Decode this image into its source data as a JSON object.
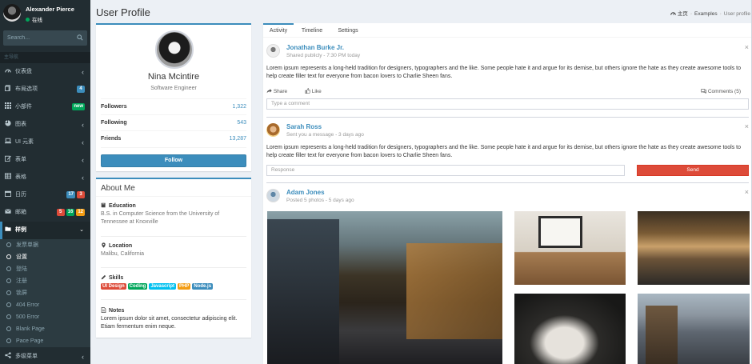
{
  "user": {
    "name": "Alexander Pierce",
    "status": "在线"
  },
  "search": {
    "placeholder": "Search..."
  },
  "sidebar": {
    "header": "主导航",
    "items": [
      {
        "label": "仪表盘",
        "icon": "dashboard-icon"
      },
      {
        "label": "布局选项",
        "icon": "files-icon",
        "badges": [
          {
            "text": "4",
            "color": "#3c8dbc"
          }
        ]
      },
      {
        "label": "小部件",
        "icon": "th-icon",
        "badges": [
          {
            "text": "new",
            "color": "#00a65a"
          }
        ]
      },
      {
        "label": "图表",
        "icon": "pie-chart-icon"
      },
      {
        "label": "UI 元素",
        "icon": "laptop-icon"
      },
      {
        "label": "表单",
        "icon": "edit-icon"
      },
      {
        "label": "表格",
        "icon": "table-icon"
      },
      {
        "label": "日历",
        "icon": "calendar-icon",
        "badges": [
          {
            "text": "17",
            "color": "#3c8dbc"
          },
          {
            "text": "3",
            "color": "#dd4b39"
          }
        ]
      },
      {
        "label": "邮箱",
        "icon": "envelope-icon",
        "badges": [
          {
            "text": "5",
            "color": "#dd4b39"
          },
          {
            "text": "16",
            "color": "#00a65a"
          },
          {
            "text": "12",
            "color": "#f39c12"
          }
        ]
      },
      {
        "label": "样例",
        "icon": "folder-icon"
      }
    ],
    "subitems": [
      "发票单据",
      "设置",
      "登陆",
      "注册",
      "锁屏",
      "404 Error",
      "500 Error",
      "Blank Page",
      "Pace Page"
    ],
    "bottom": "多级菜单"
  },
  "page": {
    "title": "User Profile"
  },
  "breadcrumb": {
    "home": "主页",
    "section": "Examples",
    "current": "User profile"
  },
  "profile": {
    "name": "Nina Mcintire",
    "job": "Software Engineer",
    "stats": [
      {
        "label": "Followers",
        "value": "1,322"
      },
      {
        "label": "Following",
        "value": "543"
      },
      {
        "label": "Friends",
        "value": "13,287"
      }
    ],
    "follow": "Follow"
  },
  "about": {
    "title": "About Me",
    "education": {
      "title": "Education",
      "text": "B.S. in Computer Science from the University of Tennessee at Knoxville"
    },
    "location": {
      "title": "Location",
      "text": "Malibu, California"
    },
    "skills": {
      "title": "Skills",
      "labels": [
        {
          "text": "UI Design",
          "color": "#dd4b39"
        },
        {
          "text": "Coding",
          "color": "#00a65a"
        },
        {
          "text": "Javascript",
          "color": "#00c0ef"
        },
        {
          "text": "PHP",
          "color": "#f39c12"
        },
        {
          "text": "Node.js",
          "color": "#3c8dbc"
        }
      ]
    },
    "notes": {
      "title": "Notes",
      "text": "Lorem ipsum dolor sit amet, consectetur adipiscing elit. Etiam fermentum enim neque."
    }
  },
  "tabs": [
    "Activity",
    "Timeline",
    "Settings"
  ],
  "posts": [
    {
      "name": "Jonathan Burke Jr.",
      "desc": "Shared publicly - 7:30 PM today",
      "text": "Lorem ipsum represents a long-held tradition for designers, typographers and the like. Some people hate it and argue for its demise, but others ignore the hate as they create awesome tools to help create filler text for everyone from bacon lovers to Charlie Sheen fans.",
      "share": "Share",
      "like": "Like",
      "comments": "Comments (5)",
      "input_placeholder": "Type a comment"
    },
    {
      "name": "Sarah Ross",
      "desc": "Sent you a message - 3 days ago",
      "text": "Lorem ipsum represents a long-held tradition for designers, typographers and the like. Some people hate it and argue for its demise, but others ignore the hate as they create awesome tools to help create filler text for everyone from bacon lovers to Charlie Sheen fans.",
      "input_placeholder": "Response",
      "send": "Send"
    },
    {
      "name": "Adam Jones",
      "desc": "Posted 5 photos - 5 days ago"
    }
  ],
  "colors": {
    "primary": "#3c8dbc",
    "danger": "#dd4b39",
    "sidebar": "#222d32"
  }
}
